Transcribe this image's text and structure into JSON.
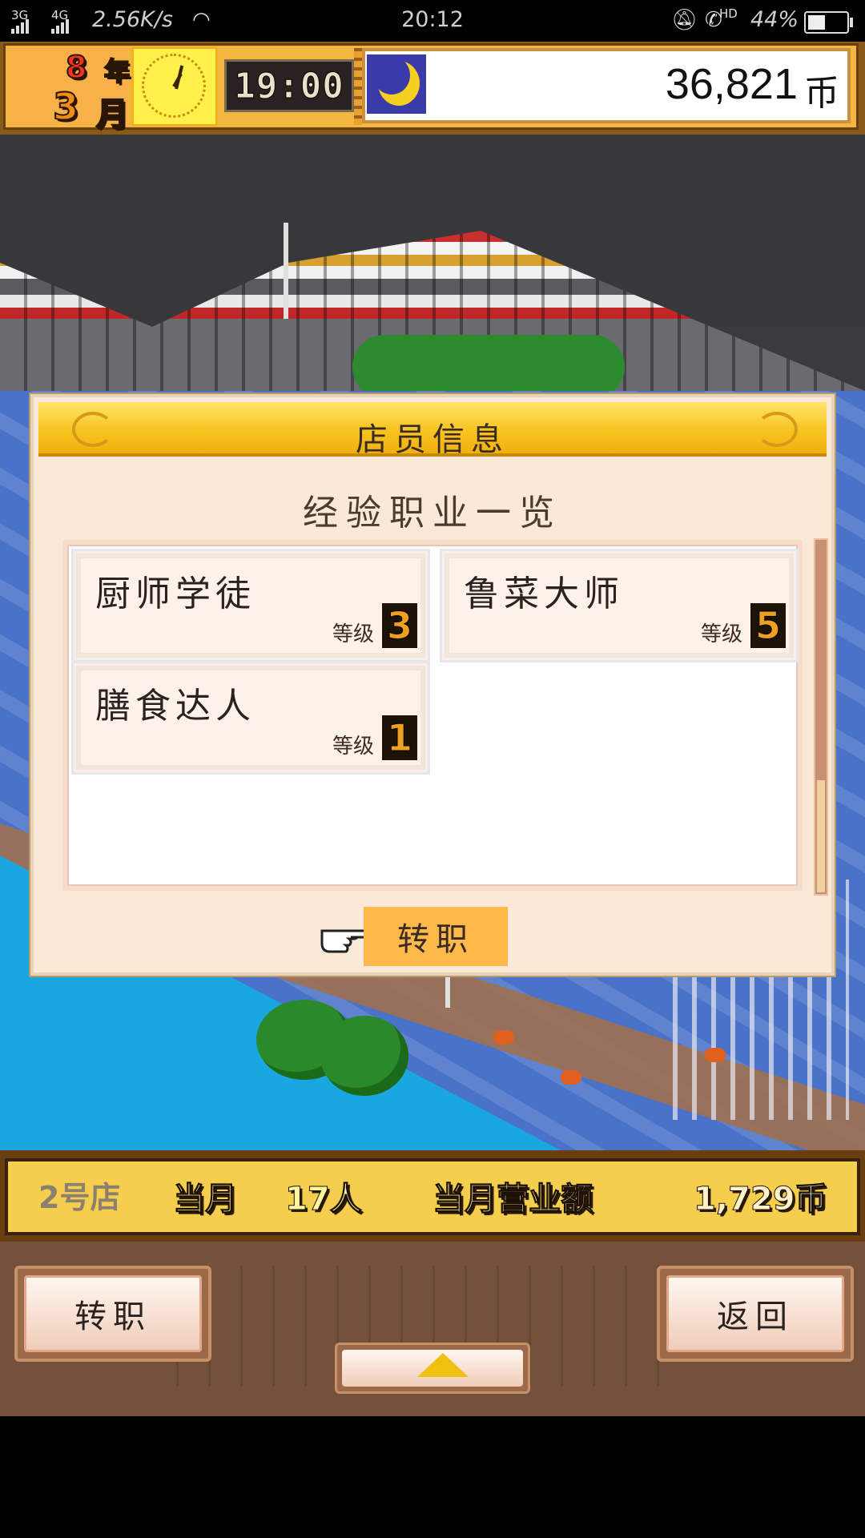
{
  "status_bar": {
    "network_1": "3G",
    "network_2": "4G",
    "speed": "2.56K/s",
    "time": "20:12",
    "hd": "HD",
    "battery": "44%",
    "battery_level": 0.44
  },
  "hud": {
    "year_num": "8",
    "year_label": "年",
    "month_num": "3",
    "month_label": "月",
    "game_time": "19:00",
    "money": "36,821",
    "money_unit": "币",
    "clock_icon": "clock-icon",
    "night_icon": "moon-icon"
  },
  "dialog": {
    "title": "店员信息",
    "subtitle": "经验职业一览",
    "level_label": "等级",
    "jobs": [
      {
        "name": "厨师学徒",
        "level": "3"
      },
      {
        "name": "鲁菜大师",
        "level": "5"
      },
      {
        "name": "膳食达人",
        "level": "1"
      }
    ],
    "action_button": "转职"
  },
  "info_bar": {
    "store": "2号店",
    "month_label": "当月",
    "staff_count": "17人",
    "sales_label": "当月营业额",
    "sales_value": "1,729币"
  },
  "bottom_panel": {
    "left_button": "转职",
    "right_button": "返回",
    "expand_icon": "up-arrow-icon"
  }
}
